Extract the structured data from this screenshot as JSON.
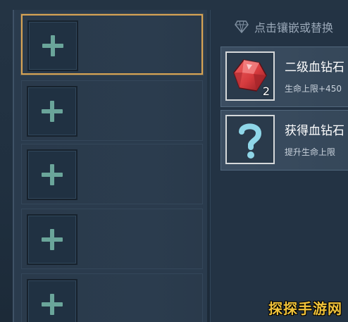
{
  "left_panel": {
    "slots": [
      {
        "state": "selected",
        "icon": "plus-icon"
      },
      {
        "state": "empty",
        "icon": "plus-icon"
      },
      {
        "state": "empty",
        "icon": "plus-icon"
      },
      {
        "state": "empty",
        "icon": "plus-icon"
      },
      {
        "state": "empty",
        "icon": "plus-icon"
      }
    ]
  },
  "right_panel": {
    "hint": "点击镶嵌或替换",
    "items": [
      {
        "title": "二级血钻石",
        "desc": "生命上限+450",
        "quantity": "2",
        "icon": "red-gem-icon"
      },
      {
        "title": "获得血钻石",
        "desc": "提升生命上限",
        "icon": "question-mark-icon"
      }
    ]
  },
  "watermark": "探探手游网",
  "colors": {
    "selected_border": "#d7a455",
    "plus": "#6aa59a",
    "gem": "#d53a3d"
  }
}
